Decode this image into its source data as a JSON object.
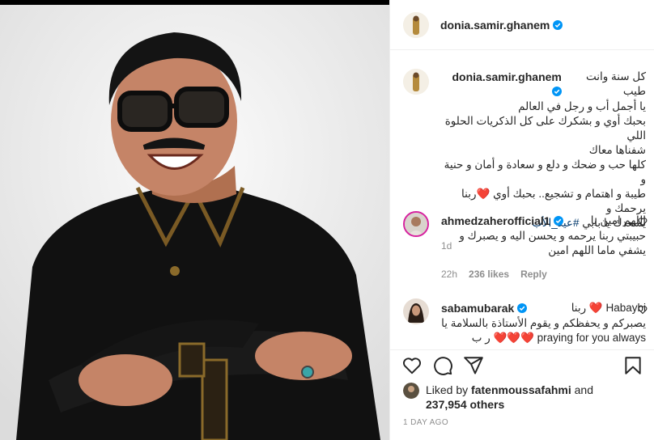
{
  "post": {
    "username": "donia.samir.ghanem",
    "media_alt": "Smiling man in black embroidered shirt with crossed arms"
  },
  "caption": {
    "username": "donia.samir.ghanem",
    "lines": [
      "كل سنة وانت طيب",
      "يا أجمل أب و رجل في العالم",
      "بحبك أوي و بشكرك على كل الذكريات الحلوة اللي",
      "شفناها معاك",
      "كلها حب و ضحك و دلع و سعادة و أمان و حنية و",
      "طيبة و اهتمام و تشجيع.. بحبك أوي ❤️ربنا يرحمك و"
    ],
    "last_line_prefix": "يسعدك يا بابي ",
    "hashtag": "#عيد_الأب",
    "age": "1d"
  },
  "comments": [
    {
      "username": "ahmedzaherofficial1",
      "lines": [
        "اللهم امين يا",
        "حبيبتي ربنا يرحمه و يحسن اليه و يصبرك و",
        "يشفي ماما اللهم امين"
      ],
      "age": "22h",
      "likes": "236 likes",
      "reply": "Reply"
    },
    {
      "username": "sabamubarak",
      "first_line": "Habaybi ❤️ ربنا",
      "lines": [
        "يصبركم و يحفظكم و يقوم الأستاذة بالسلامة يا",
        "praying for you always ❤️❤️❤️ ر ب"
      ]
    }
  ],
  "likes": {
    "prefix": "Liked by ",
    "user": "fatenmoussafahmi",
    "and": " and",
    "others": "237,954 others"
  },
  "date": "1 DAY AGO",
  "colors": {
    "verified": "#0095f6",
    "link": "#00376b",
    "muted": "#8e8e8e",
    "text": "#262626"
  }
}
